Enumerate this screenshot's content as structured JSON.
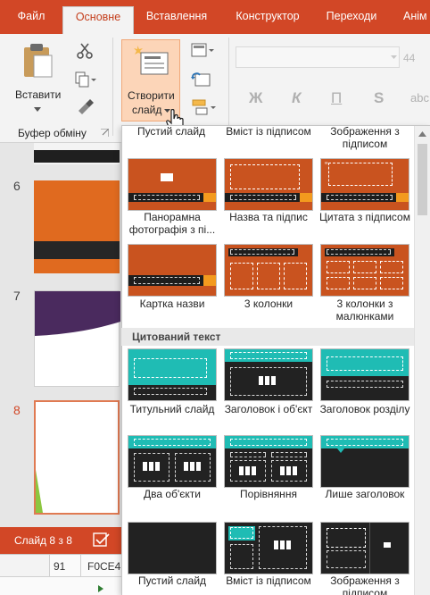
{
  "tabs": [
    "Файл",
    "Основне",
    "Вставлення",
    "Конструктор",
    "Переходи",
    "Анім"
  ],
  "ribbon": {
    "paste_label": "Вставити",
    "clipboard_group": "Буфер обміну",
    "new_slide_line1": "Створити",
    "new_slide_line2": "слайд",
    "font_size": "44",
    "font_buttons": [
      "Ж",
      "К",
      "П",
      "S",
      "abc"
    ]
  },
  "slides": {
    "numbers": [
      "6",
      "7",
      "8"
    ],
    "status": "Слайд 8 з 8"
  },
  "sheet": {
    "row": "91",
    "cell": "F0CE4"
  },
  "gallery": {
    "top_labels": [
      "Пустий слайд",
      "Вміст із підписом",
      "Зображення з підписом"
    ],
    "row1": [
      "Панорамна фотографія з пі...",
      "Назва та підпис",
      "Цитата з підписом"
    ],
    "row2": [
      "Картка назви",
      "3 колонки",
      "3 колонки з малюнками"
    ],
    "section_title": "Цитований текст",
    "row3": [
      "Титульний слайд",
      "Заголовок і об'єкт",
      "Заголовок розділу"
    ],
    "row4": [
      "Два об'єкти",
      "Порівняння",
      "Лише заголовок"
    ],
    "row5": [
      "Пустий слайд",
      "Вміст із підписом",
      "Зображення з підписом"
    ]
  },
  "colors": {
    "accent": "#d24726",
    "orange_theme": "#c8501e",
    "teal_theme": "#1fbcb4",
    "dark_theme": "#222222"
  }
}
